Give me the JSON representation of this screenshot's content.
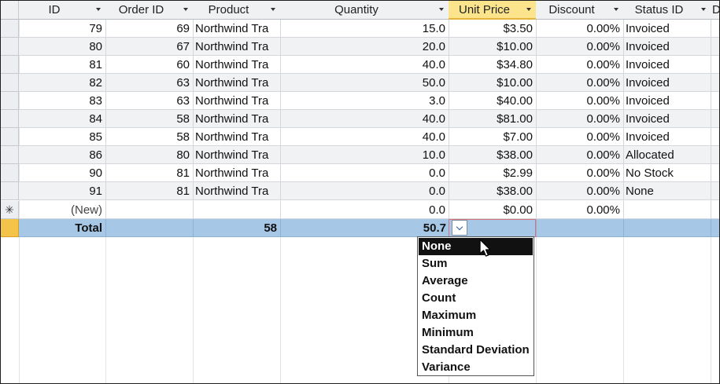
{
  "columns": [
    {
      "label": "ID"
    },
    {
      "label": "Order ID"
    },
    {
      "label": "Product"
    },
    {
      "label": "Quantity"
    },
    {
      "label": "Unit Price"
    },
    {
      "label": "Discount"
    },
    {
      "label": "Status ID"
    },
    {
      "label": "D"
    }
  ],
  "rows": [
    {
      "id": "79",
      "order": "69",
      "product": "Northwind Tra",
      "qty": "15.0",
      "price": "$3.50",
      "disc": "0.00%",
      "status": "Invoiced"
    },
    {
      "id": "80",
      "order": "67",
      "product": "Northwind Tra",
      "qty": "20.0",
      "price": "$10.00",
      "disc": "0.00%",
      "status": "Invoiced"
    },
    {
      "id": "81",
      "order": "60",
      "product": "Northwind Tra",
      "qty": "40.0",
      "price": "$34.80",
      "disc": "0.00%",
      "status": "Invoiced"
    },
    {
      "id": "82",
      "order": "63",
      "product": "Northwind Tra",
      "qty": "50.0",
      "price": "$10.00",
      "disc": "0.00%",
      "status": "Invoiced"
    },
    {
      "id": "83",
      "order": "63",
      "product": "Northwind Tra",
      "qty": "3.0",
      "price": "$40.00",
      "disc": "0.00%",
      "status": "Invoiced"
    },
    {
      "id": "84",
      "order": "58",
      "product": "Northwind Tra",
      "qty": "40.0",
      "price": "$81.00",
      "disc": "0.00%",
      "status": "Invoiced"
    },
    {
      "id": "85",
      "order": "58",
      "product": "Northwind Tra",
      "qty": "40.0",
      "price": "$7.00",
      "disc": "0.00%",
      "status": "Invoiced"
    },
    {
      "id": "86",
      "order": "80",
      "product": "Northwind Tra",
      "qty": "10.0",
      "price": "$38.00",
      "disc": "0.00%",
      "status": "Allocated"
    },
    {
      "id": "90",
      "order": "81",
      "product": "Northwind Tra",
      "qty": "0.0",
      "price": "$2.99",
      "disc": "0.00%",
      "status": "No Stock"
    },
    {
      "id": "91",
      "order": "81",
      "product": "Northwind Tra",
      "qty": "0.0",
      "price": "$38.00",
      "disc": "0.00%",
      "status": "None"
    }
  ],
  "new_row": {
    "marker": "✳",
    "id": "(New)",
    "qty": "0.0",
    "price": "$0.00",
    "disc": "0.00%"
  },
  "total_row": {
    "label": "Total",
    "product": "58",
    "qty": "50.7"
  },
  "aggregate_options": [
    "None",
    "Sum",
    "Average",
    "Count",
    "Maximum",
    "Minimum",
    "Standard Deviation",
    "Variance"
  ],
  "selected_option": "None",
  "icons": {
    "dropdown": "chevron-down-icon",
    "cursor": "mouse-pointer-icon",
    "new_row": "asterisk-icon"
  }
}
